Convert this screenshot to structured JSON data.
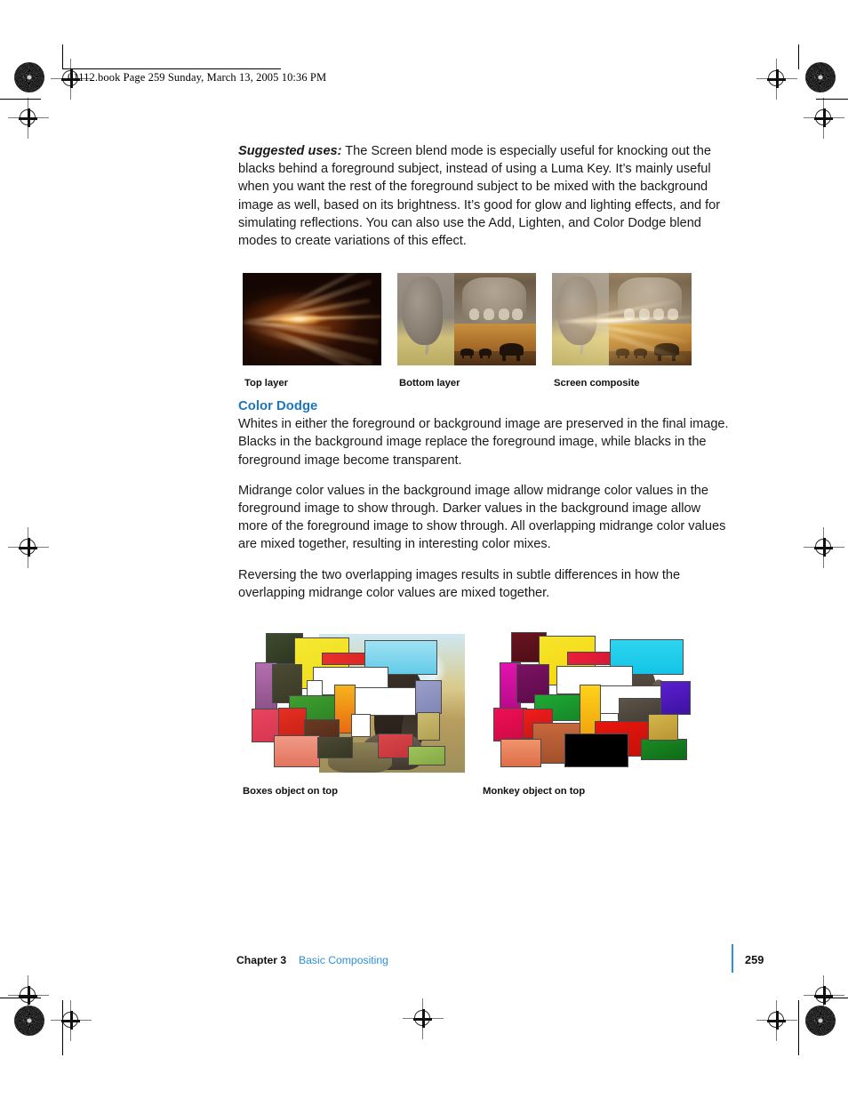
{
  "page": {
    "header_line": "01112.book  Page 259  Sunday, March 13, 2005  10:36 PM",
    "number": "259"
  },
  "colors": {
    "heading_blue": "#1b76bd",
    "footer_link_blue": "#2f8fd8",
    "body_text": "#1a1a1a"
  },
  "body": {
    "suggested_uses_label": "Suggested uses:",
    "suggested_uses_text": " The Screen blend mode is especially useful for knocking out the blacks behind a foreground subject, instead of using a Luma Key. It’s mainly useful when you want the rest of the foreground subject to be mixed with the background image as well, based on its brightness. It’s good for glow and lighting effects, and for simulating reflections. You can also use the Add, Lighten, and Color Dodge blend modes to create variations of this effect.",
    "color_dodge_heading": "Color Dodge",
    "paragraph_1": "Whites in either the foreground or background image are preserved in the final image. Blacks in the background image replace the foreground image, while blacks in the foreground image become transparent.",
    "paragraph_2": "Midrange color values in the background image allow midrange color values in the foreground image to show through. Darker values in the background image allow more of the foreground image to show through. All overlapping midrange color values are mixed together, resulting in interesting color mixes.",
    "paragraph_3": "Reversing the two overlapping images results in subtle differences in how the overlapping midrange color values are mixed together."
  },
  "figures_row1": [
    {
      "caption": "Top layer",
      "alt": "light-streaks-image"
    },
    {
      "caption": "Bottom layer",
      "alt": "elephant-collage-image"
    },
    {
      "caption": "Screen composite",
      "alt": "screen-composite-image"
    }
  ],
  "figures_row2": [
    {
      "caption": "Boxes object on top",
      "alt": "color-dodge-boxes-on-top-image"
    },
    {
      "caption": "Monkey object on top",
      "alt": "color-dodge-monkey-on-top-image"
    }
  ],
  "footer": {
    "chapter": "Chapter 3",
    "chapter_title": "Basic Compositing",
    "page_number": "259"
  }
}
